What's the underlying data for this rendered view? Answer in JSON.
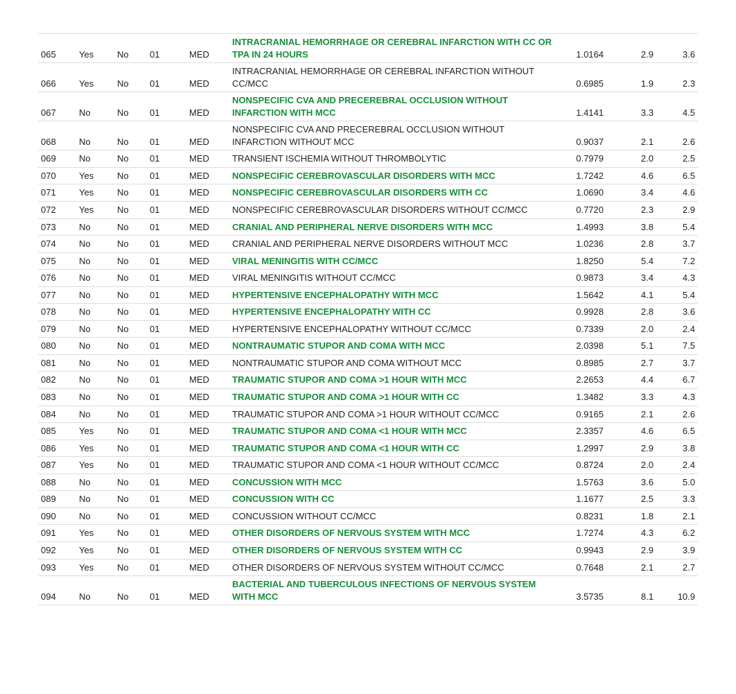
{
  "rows": [
    {
      "drg": "065",
      "pmdc": "Yes",
      "spec": "No",
      "mdc": "01",
      "type": "MED",
      "title": "INTRACRANIAL HEMORRHAGE OR CEREBRAL INFARCTION WITH CC OR TPA IN 24 HOURS",
      "green": true,
      "w": "1.0164",
      "g": "2.9",
      "a": "3.6"
    },
    {
      "drg": "066",
      "pmdc": "Yes",
      "spec": "No",
      "mdc": "01",
      "type": "MED",
      "title": "INTRACRANIAL HEMORRHAGE OR CEREBRAL INFARCTION WITHOUT CC/MCC",
      "green": false,
      "w": "0.6985",
      "g": "1.9",
      "a": "2.3"
    },
    {
      "drg": "067",
      "pmdc": "No",
      "spec": "No",
      "mdc": "01",
      "type": "MED",
      "title": "NONSPECIFIC CVA AND PRECEREBRAL OCCLUSION WITHOUT INFARCTION WITH MCC",
      "green": true,
      "w": "1.4141",
      "g": "3.3",
      "a": "4.5"
    },
    {
      "drg": "068",
      "pmdc": "No",
      "spec": "No",
      "mdc": "01",
      "type": "MED",
      "title": "NONSPECIFIC CVA AND PRECEREBRAL OCCLUSION WITHOUT INFARCTION WITHOUT MCC",
      "green": false,
      "w": "0.9037",
      "g": "2.1",
      "a": "2.6"
    },
    {
      "drg": "069",
      "pmdc": "No",
      "spec": "No",
      "mdc": "01",
      "type": "MED",
      "title": "TRANSIENT ISCHEMIA WITHOUT THROMBOLYTIC",
      "green": false,
      "w": "0.7979",
      "g": "2.0",
      "a": "2.5"
    },
    {
      "drg": "070",
      "pmdc": "Yes",
      "spec": "No",
      "mdc": "01",
      "type": "MED",
      "title": "NONSPECIFIC CEREBROVASCULAR DISORDERS WITH MCC",
      "green": true,
      "w": "1.7242",
      "g": "4.6",
      "a": "6.5"
    },
    {
      "drg": "071",
      "pmdc": "Yes",
      "spec": "No",
      "mdc": "01",
      "type": "MED",
      "title": "NONSPECIFIC CEREBROVASCULAR DISORDERS WITH CC",
      "green": true,
      "w": "1.0690",
      "g": "3.4",
      "a": "4.6"
    },
    {
      "drg": "072",
      "pmdc": "Yes",
      "spec": "No",
      "mdc": "01",
      "type": "MED",
      "title": "NONSPECIFIC CEREBROVASCULAR DISORDERS WITHOUT CC/MCC",
      "green": false,
      "w": "0.7720",
      "g": "2.3",
      "a": "2.9"
    },
    {
      "drg": "073",
      "pmdc": "No",
      "spec": "No",
      "mdc": "01",
      "type": "MED",
      "title": "CRANIAL AND PERIPHERAL NERVE DISORDERS WITH MCC",
      "green": true,
      "w": "1.4993",
      "g": "3.8",
      "a": "5.4"
    },
    {
      "drg": "074",
      "pmdc": "No",
      "spec": "No",
      "mdc": "01",
      "type": "MED",
      "title": "CRANIAL AND PERIPHERAL NERVE DISORDERS WITHOUT MCC",
      "green": false,
      "w": "1.0236",
      "g": "2.8",
      "a": "3.7"
    },
    {
      "drg": "075",
      "pmdc": "No",
      "spec": "No",
      "mdc": "01",
      "type": "MED",
      "title": "VIRAL MENINGITIS WITH CC/MCC",
      "green": true,
      "w": "1.8250",
      "g": "5.4",
      "a": "7.2"
    },
    {
      "drg": "076",
      "pmdc": "No",
      "spec": "No",
      "mdc": "01",
      "type": "MED",
      "title": "VIRAL MENINGITIS WITHOUT CC/MCC",
      "green": false,
      "w": "0.9873",
      "g": "3.4",
      "a": "4.3"
    },
    {
      "drg": "077",
      "pmdc": "No",
      "spec": "No",
      "mdc": "01",
      "type": "MED",
      "title": "HYPERTENSIVE ENCEPHALOPATHY WITH MCC",
      "green": true,
      "w": "1.5642",
      "g": "4.1",
      "a": "5.4"
    },
    {
      "drg": "078",
      "pmdc": "No",
      "spec": "No",
      "mdc": "01",
      "type": "MED",
      "title": "HYPERTENSIVE ENCEPHALOPATHY WITH CC",
      "green": true,
      "w": "0.9928",
      "g": "2.8",
      "a": "3.6"
    },
    {
      "drg": "079",
      "pmdc": "No",
      "spec": "No",
      "mdc": "01",
      "type": "MED",
      "title": "HYPERTENSIVE ENCEPHALOPATHY WITHOUT CC/MCC",
      "green": false,
      "w": "0.7339",
      "g": "2.0",
      "a": "2.4"
    },
    {
      "drg": "080",
      "pmdc": "No",
      "spec": "No",
      "mdc": "01",
      "type": "MED",
      "title": "NONTRAUMATIC STUPOR AND COMA WITH MCC",
      "green": true,
      "w": "2.0398",
      "g": "5.1",
      "a": "7.5"
    },
    {
      "drg": "081",
      "pmdc": "No",
      "spec": "No",
      "mdc": "01",
      "type": "MED",
      "title": "NONTRAUMATIC STUPOR AND COMA WITHOUT MCC",
      "green": false,
      "w": "0.8985",
      "g": "2.7",
      "a": "3.7"
    },
    {
      "drg": "082",
      "pmdc": "No",
      "spec": "No",
      "mdc": "01",
      "type": "MED",
      "title": "TRAUMATIC STUPOR AND COMA >1 HOUR WITH MCC",
      "green": true,
      "w": "2.2653",
      "g": "4.4",
      "a": "6.7"
    },
    {
      "drg": "083",
      "pmdc": "No",
      "spec": "No",
      "mdc": "01",
      "type": "MED",
      "title": "TRAUMATIC STUPOR AND COMA >1 HOUR WITH CC",
      "green": true,
      "w": "1.3482",
      "g": "3.3",
      "a": "4.3"
    },
    {
      "drg": "084",
      "pmdc": "No",
      "spec": "No",
      "mdc": "01",
      "type": "MED",
      "title": "TRAUMATIC STUPOR AND COMA >1 HOUR WITHOUT CC/MCC",
      "green": false,
      "w": "0.9165",
      "g": "2.1",
      "a": "2.6"
    },
    {
      "drg": "085",
      "pmdc": "Yes",
      "spec": "No",
      "mdc": "01",
      "type": "MED",
      "title": "TRAUMATIC STUPOR AND COMA <1 HOUR WITH MCC",
      "green": true,
      "w": "2.3357",
      "g": "4.6",
      "a": "6.5"
    },
    {
      "drg": "086",
      "pmdc": "Yes",
      "spec": "No",
      "mdc": "01",
      "type": "MED",
      "title": "TRAUMATIC STUPOR AND COMA <1 HOUR WITH CC",
      "green": true,
      "w": "1.2997",
      "g": "2.9",
      "a": "3.8"
    },
    {
      "drg": "087",
      "pmdc": "Yes",
      "spec": "No",
      "mdc": "01",
      "type": "MED",
      "title": "TRAUMATIC STUPOR AND COMA <1 HOUR WITHOUT CC/MCC",
      "green": false,
      "w": "0.8724",
      "g": "2.0",
      "a": "2.4"
    },
    {
      "drg": "088",
      "pmdc": "No",
      "spec": "No",
      "mdc": "01",
      "type": "MED",
      "title": "CONCUSSION WITH MCC",
      "green": true,
      "w": "1.5763",
      "g": "3.6",
      "a": "5.0"
    },
    {
      "drg": "089",
      "pmdc": "No",
      "spec": "No",
      "mdc": "01",
      "type": "MED",
      "title": "CONCUSSION WITH CC",
      "green": true,
      "w": "1.1677",
      "g": "2.5",
      "a": "3.3"
    },
    {
      "drg": "090",
      "pmdc": "No",
      "spec": "No",
      "mdc": "01",
      "type": "MED",
      "title": "CONCUSSION WITHOUT CC/MCC",
      "green": false,
      "w": "0.8231",
      "g": "1.8",
      "a": "2.1"
    },
    {
      "drg": "091",
      "pmdc": "Yes",
      "spec": "No",
      "mdc": "01",
      "type": "MED",
      "title": "OTHER DISORDERS OF NERVOUS SYSTEM WITH MCC",
      "green": true,
      "w": "1.7274",
      "g": "4.3",
      "a": "6.2"
    },
    {
      "drg": "092",
      "pmdc": "Yes",
      "spec": "No",
      "mdc": "01",
      "type": "MED",
      "title": "OTHER DISORDERS OF NERVOUS SYSTEM WITH CC",
      "green": true,
      "w": "0.9943",
      "g": "2.9",
      "a": "3.9"
    },
    {
      "drg": "093",
      "pmdc": "Yes",
      "spec": "No",
      "mdc": "01",
      "type": "MED",
      "title": "OTHER DISORDERS OF NERVOUS SYSTEM WITHOUT CC/MCC",
      "green": false,
      "w": "0.7648",
      "g": "2.1",
      "a": "2.7"
    },
    {
      "drg": "094",
      "pmdc": "No",
      "spec": "No",
      "mdc": "01",
      "type": "MED",
      "title": "BACTERIAL AND TUBERCULOUS INFECTIONS OF NERVOUS SYSTEM WITH MCC",
      "green": true,
      "w": "3.5735",
      "g": "8.1",
      "a": "10.9"
    }
  ]
}
